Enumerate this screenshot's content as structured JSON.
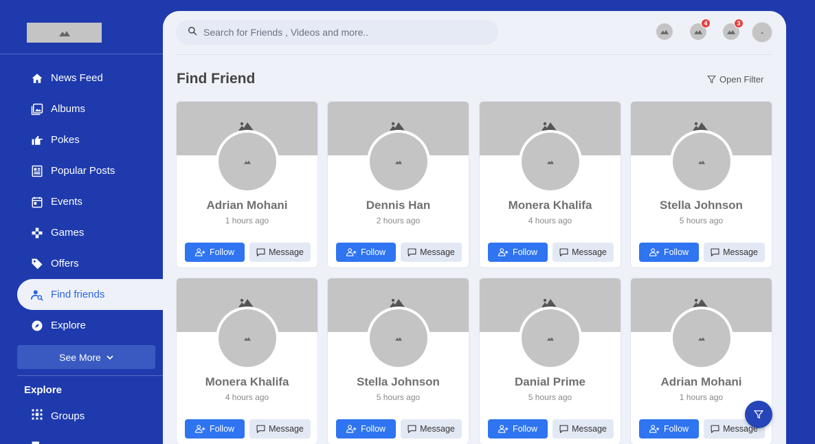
{
  "sidebar": {
    "items": [
      {
        "label": "News Feed",
        "icon": "home-icon"
      },
      {
        "label": "Albums",
        "icon": "albums-icon"
      },
      {
        "label": "Pokes",
        "icon": "thumb-point-icon"
      },
      {
        "label": "Popular Posts",
        "icon": "document-icon"
      },
      {
        "label": "Events",
        "icon": "calendar-icon"
      },
      {
        "label": "Games",
        "icon": "gamepad-icon"
      },
      {
        "label": "Offers",
        "icon": "tag-icon"
      },
      {
        "label": "Find friends",
        "icon": "user-search-icon",
        "active": true
      },
      {
        "label": "Explore",
        "icon": "compass-icon"
      }
    ],
    "see_more": "See More",
    "section_title": "Explore",
    "groups_label": "Groups"
  },
  "header": {
    "search_placeholder": "Search for Friends , Videos and more..",
    "badges": {
      "notifications": "4",
      "messages": "3"
    }
  },
  "page": {
    "title": "Find Friend",
    "open_filter": "Open Filter"
  },
  "cards": [
    {
      "name": "Adrian Mohani",
      "time": "1 hours ago"
    },
    {
      "name": "Dennis Han",
      "time": "2 hours ago"
    },
    {
      "name": "Monera Khalifa",
      "time": "4 hours ago"
    },
    {
      "name": "Stella Johnson",
      "time": "5 hours ago"
    },
    {
      "name": "Monera Khalifa",
      "time": "4 hours ago"
    },
    {
      "name": "Stella Johnson",
      "time": "5 hours ago"
    },
    {
      "name": "Danial Prime",
      "time": "5 hours ago"
    },
    {
      "name": "Adrian Mohani",
      "time": "1 hours ago"
    }
  ],
  "buttons": {
    "follow": "Follow",
    "message": "Message"
  },
  "colors": {
    "sidebar": "#1e3aad",
    "accent": "#2f74f0",
    "content_bg": "#eef1f8"
  }
}
